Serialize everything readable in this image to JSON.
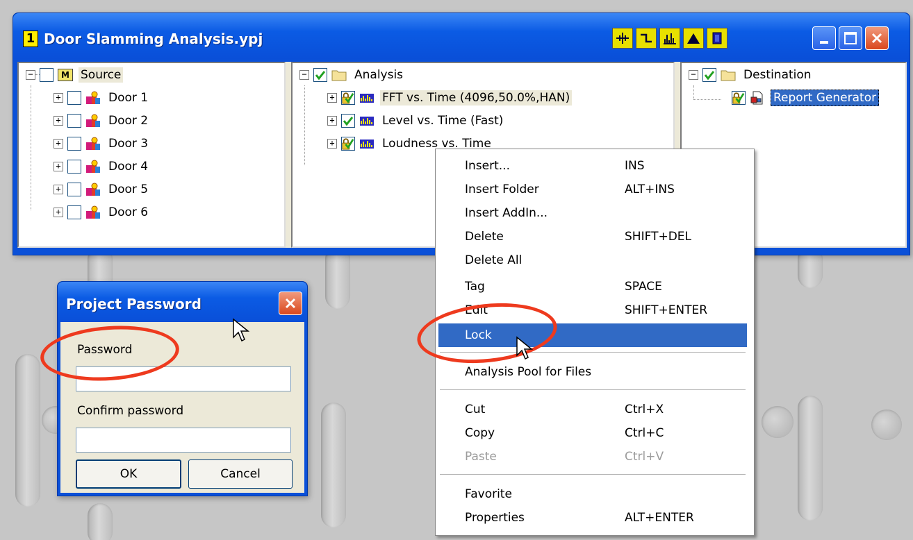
{
  "window": {
    "number": "1",
    "title": "Door Slamming Analysis.ypj",
    "toolbar_icons": [
      "crosshair-icon",
      "step-icon",
      "spectrum-icon",
      "peak-icon",
      "window-icon"
    ],
    "controls": [
      "minimize-icon",
      "maximize-icon",
      "close-icon"
    ]
  },
  "source_pane": {
    "root": {
      "expander": "−",
      "icon_text": "M",
      "label": "Source"
    },
    "items": [
      {
        "expander": "+",
        "label": "Door 1"
      },
      {
        "expander": "+",
        "label": "Door 2"
      },
      {
        "expander": "+",
        "label": "Door 3"
      },
      {
        "expander": "+",
        "label": "Door 4"
      },
      {
        "expander": "+",
        "label": "Door 5"
      },
      {
        "expander": "+",
        "label": "Door 6"
      }
    ]
  },
  "analysis_pane": {
    "root": {
      "expander": "−",
      "label": "Analysis",
      "checked": true
    },
    "items": [
      {
        "expander": "+",
        "label": "FFT vs. Time (4096,50.0%,HAN)",
        "state": "locked"
      },
      {
        "expander": "+",
        "label": "Level vs. Time (Fast)",
        "state": "checked"
      },
      {
        "expander": "+",
        "label": "Loudness vs. Time",
        "state": "locked"
      }
    ]
  },
  "destination_pane": {
    "root": {
      "expander": "−",
      "label": "Destination",
      "checked": true
    },
    "items": [
      {
        "label": "Report Generator",
        "state": "locked",
        "selected": true
      }
    ]
  },
  "context_menu": {
    "groups": [
      [
        {
          "label": "Insert...",
          "shortcut": "INS"
        },
        {
          "label": "Insert Folder",
          "shortcut": "ALT+INS"
        },
        {
          "label": "Insert AddIn...",
          "shortcut": ""
        },
        {
          "label": "Delete",
          "shortcut": "SHIFT+DEL"
        },
        {
          "label": "Delete All",
          "shortcut": ""
        },
        {
          "label": "Tag",
          "shortcut": "SPACE"
        },
        {
          "label": "Edit",
          "shortcut": "SHIFT+ENTER"
        },
        {
          "label": "Lock",
          "shortcut": "",
          "highlighted": true
        }
      ],
      [
        {
          "label": "Analysis Pool for Files",
          "shortcut": ""
        }
      ],
      [
        {
          "label": "Cut",
          "shortcut": "Ctrl+X"
        },
        {
          "label": "Copy",
          "shortcut": "Ctrl+C"
        },
        {
          "label": "Paste",
          "shortcut": "Ctrl+V",
          "disabled": true
        }
      ],
      [
        {
          "label": "Favorite",
          "shortcut": ""
        },
        {
          "label": "Properties",
          "shortcut": "ALT+ENTER"
        }
      ]
    ]
  },
  "dialog": {
    "title": "Project Password",
    "password_label": "Password",
    "password_value": "",
    "confirm_label": "Confirm password",
    "confirm_value": "",
    "ok_label": "OK",
    "cancel_label": "Cancel"
  },
  "colors": {
    "titlebar": "#0a50d8",
    "selection": "#316ac5",
    "annotation": "#ee3a1e",
    "toolbar_button": "#e8e000"
  }
}
